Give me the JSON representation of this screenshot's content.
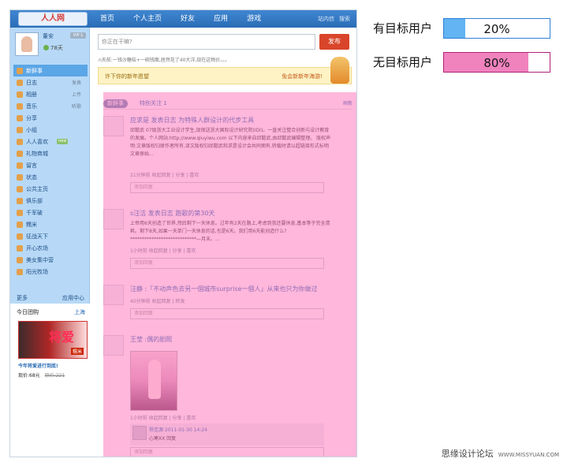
{
  "colors": {
    "nav_bar": "#2f78c4",
    "sidebar_bg": "#b7d9f7",
    "overlay_pink": "#ff69b4",
    "target_blue": "#62b4f2",
    "target_pink": "#f083bd",
    "target_blue_border": "#2f7fd6",
    "target_pink_border": "#b0207a"
  },
  "topbar": {
    "logo": "人人网",
    "nav": [
      "首页",
      "个人主页",
      "好友",
      "应用",
      "游戏"
    ],
    "right": [
      "站内信",
      "搜索"
    ]
  },
  "sidebar": {
    "user_name": "董安",
    "vip": "VIP 1",
    "days": "78天",
    "items": [
      {
        "label": "新鲜事",
        "side": "",
        "active": true
      },
      {
        "label": "日志",
        "side": "发表"
      },
      {
        "label": "相册",
        "side": "上传"
      },
      {
        "label": "音乐",
        "side": "听歌"
      },
      {
        "label": "分享",
        "side": ""
      },
      {
        "label": "小组",
        "side": ""
      },
      {
        "label": "人人喜欢",
        "side": "",
        "badge": "new"
      },
      {
        "label": "礼物商城",
        "side": ""
      },
      {
        "label": "留言",
        "side": ""
      },
      {
        "label": "状态",
        "side": ""
      },
      {
        "label": "公共主页",
        "side": ""
      },
      {
        "label": "俱乐部",
        "side": ""
      },
      {
        "label": "千军破",
        "side": ""
      },
      {
        "label": "糯米",
        "side": ""
      },
      {
        "label": "征战天下",
        "side": ""
      },
      {
        "label": "开心农场",
        "side": ""
      },
      {
        "label": "美女集中营",
        "side": ""
      },
      {
        "label": "阳光牧场",
        "side": ""
      }
    ],
    "more": "更多",
    "app_center": "应用中心"
  },
  "tuan": {
    "title": "今日团购",
    "region": "上海",
    "poster_text": "将爱",
    "poster_tag": "糯米",
    "desc": "今年将爱进行到底!",
    "price": "现价:68元",
    "orig_price": "原价:221"
  },
  "composer": {
    "placeholder": "你正在干嘛?",
    "button": "发布",
    "status_line": "n天前:一钱沙糖桔+一碗钱面,居然花了40大洋,现在这物价。。。",
    "banner_left": "许下你的新年愿望",
    "banner_right": "免会新新年海游!"
  },
  "feed": {
    "tab_active": "新鲜事",
    "tab_special": "特别关注",
    "tab_special_count": "1",
    "refresh": "刷新",
    "posts": [
      {
        "title": "应求是 发表日志 为特殊人群设计的代步工具",
        "body": "邱懿武 07级浙大工业设计学生,现保送浙大国际设计研究院(IDI)。一直关注整合创新与设计教育的发展。个人网站:http://www.qiuyiwu.com 以下内容来自邱懿武,由邱懿武编辑整理。 版权声明:文章版权归原作者所有,译文版权归邱懿武和求是设计会共同拥有,转载时请以超链接形式标明文章原始...",
        "meta": "21分钟前  收起回复 | 分享 | 喜欢",
        "reply": "添加回复"
      },
      {
        "title": "s汪洁  发表日志 跑歌的第30天",
        "body": "上帝用6天创造了世界,然后剩下一天休息。过年有2天在路上,考虑到我还要休息,基本等于完全清耗。剩下8天,如果一天单门一天休息的话,也是6天。我们用6天能创造什么?****************************—月末。...",
        "meta": "1小时前  收起回复 | 分享 | 喜欢",
        "reply": "添加回复"
      },
      {
        "title": "汪静 :「不动声色去另一個城市surprise一個人」从来也只为你做过",
        "meta": "40分钟前  收起回复 | 转发",
        "reply": "添加回复"
      },
      {
        "title": "王莹 :偶的剧照",
        "meta": "1小时前  收起回复 | 分享 | 喜欢",
        "comment_name": "杨佳源  2011-01-30 14:24",
        "comment_text": "心寒XX 回复",
        "reply": "添加回复"
      }
    ]
  },
  "legend": {
    "targeted": {
      "label": "有目标用户",
      "percent": 20,
      "text": "20%"
    },
    "untargeted": {
      "label": "无目标用户",
      "percent": 80,
      "text": "80%"
    }
  },
  "footer": {
    "site_name": "思缘设计论坛",
    "url": "WWW.MISSYUAN.COM"
  }
}
